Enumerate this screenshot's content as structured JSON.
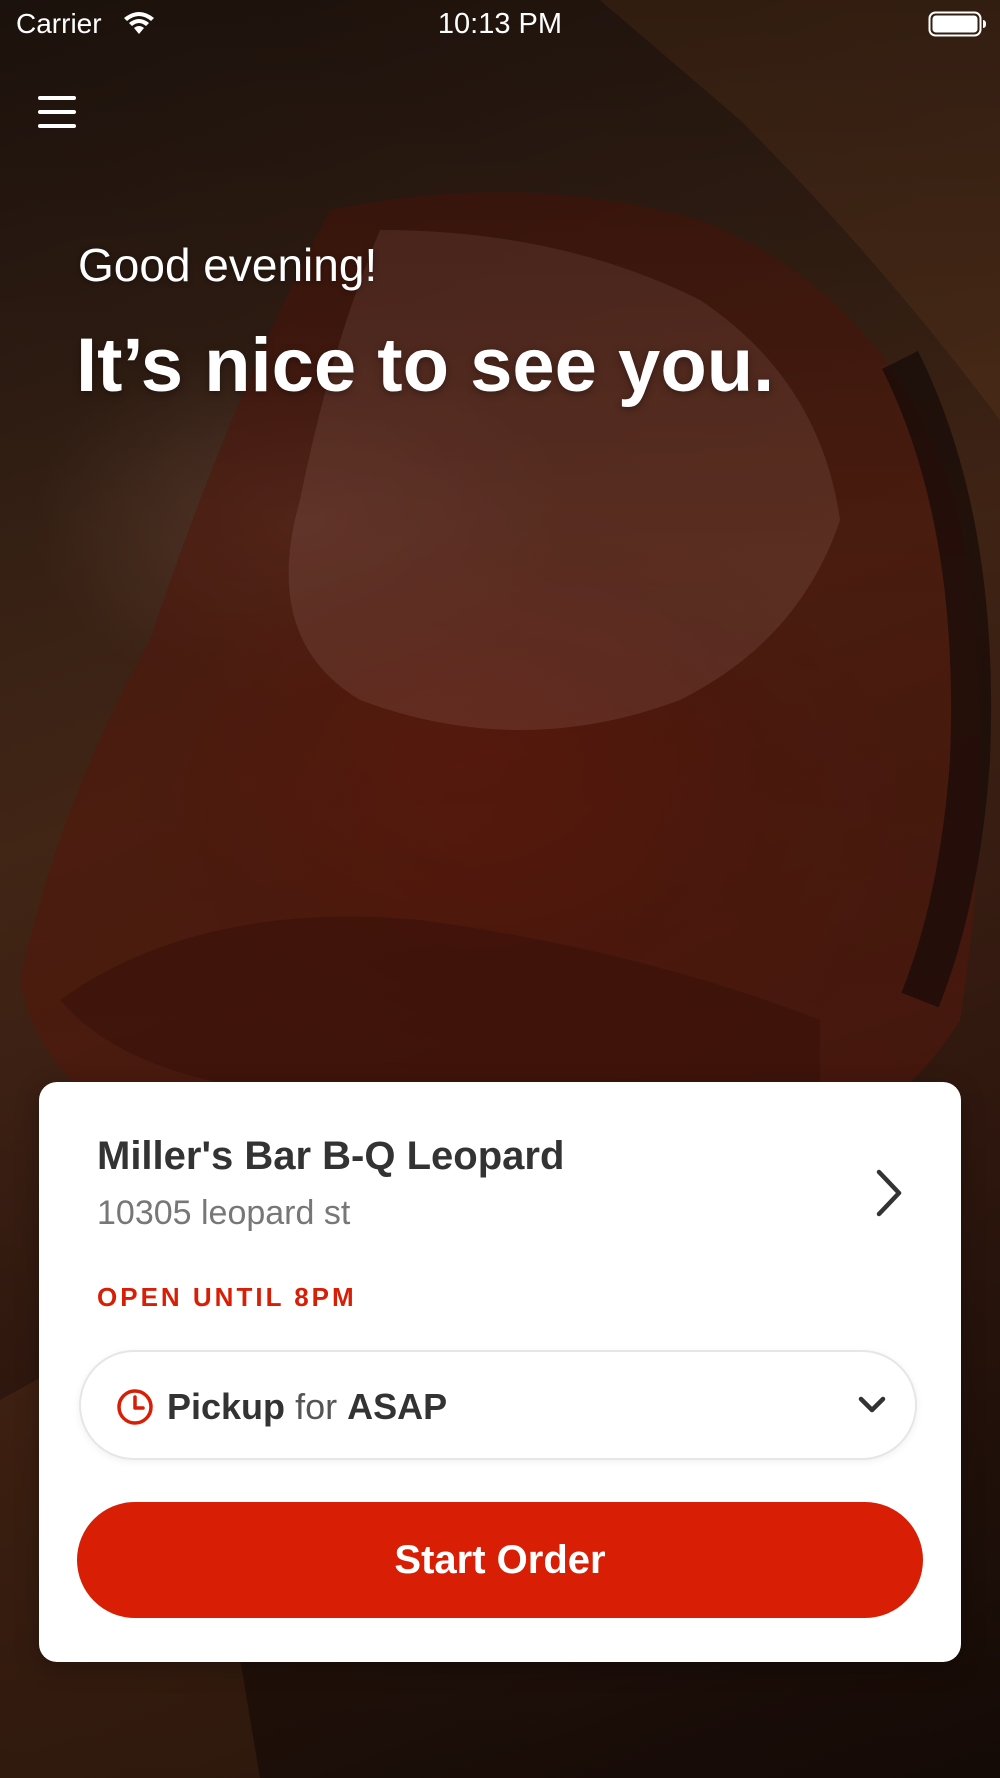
{
  "status_bar": {
    "carrier": "Carrier",
    "time": "10:13 PM",
    "wifi_icon": "wifi-icon",
    "battery_icon": "battery-icon"
  },
  "header": {
    "menu_icon": "menu-icon"
  },
  "hero": {
    "greeting": "Good evening!",
    "headline": "It’s nice to see you."
  },
  "location_card": {
    "store_name": "Miller's Bar B-Q Leopard",
    "address": "10305 leopard st",
    "open_status": "OPEN UNTIL 8PM",
    "chevron_icon": "chevron-right-icon",
    "order_mode": {
      "icon": "clock-icon",
      "mode_label": "Pickup",
      "connector": "for",
      "time_label": "ASAP",
      "dropdown_icon": "chevron-down-icon"
    },
    "start_order_label": "Start Order"
  },
  "colors": {
    "brand_red": "#d81e05",
    "card_background": "#ffffff",
    "store_name_text": "#333333",
    "address_text": "#777777"
  }
}
